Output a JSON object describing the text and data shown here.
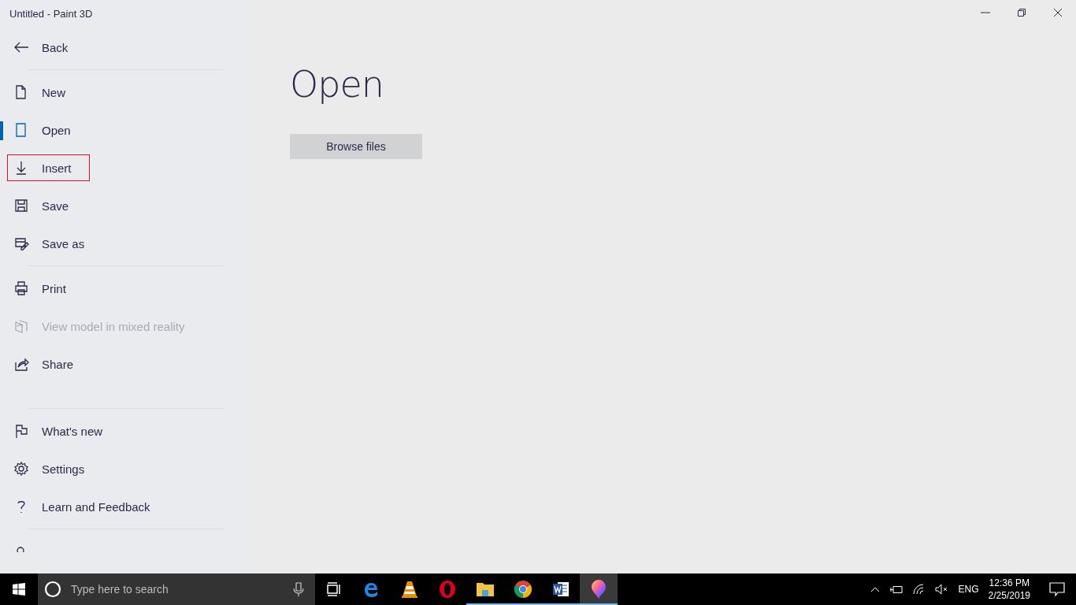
{
  "window": {
    "title": "Untitled - Paint 3D"
  },
  "sidebar": {
    "back": "Back",
    "groups": [
      [
        {
          "label": "New",
          "selected": false,
          "disabled": false,
          "focused": false
        },
        {
          "label": "Open",
          "selected": true,
          "disabled": false,
          "focused": false
        },
        {
          "label": "Insert",
          "selected": false,
          "disabled": false,
          "focused": true
        },
        {
          "label": "Save",
          "selected": false,
          "disabled": false,
          "focused": false
        },
        {
          "label": "Save as",
          "selected": false,
          "disabled": false,
          "focused": false
        }
      ],
      [
        {
          "label": "Print",
          "selected": false,
          "disabled": false,
          "focused": false
        },
        {
          "label": "View model in mixed reality",
          "selected": false,
          "disabled": true,
          "focused": false
        },
        {
          "label": "Share",
          "selected": false,
          "disabled": false,
          "focused": false
        }
      ],
      [
        {
          "label": "What's new",
          "selected": false,
          "disabled": false,
          "focused": false
        },
        {
          "label": "Settings",
          "selected": false,
          "disabled": false,
          "focused": false
        },
        {
          "label": "Learn and Feedback",
          "selected": false,
          "disabled": false,
          "focused": false
        }
      ]
    ]
  },
  "main": {
    "heading": "Open",
    "button": "Browse files"
  },
  "taskbar": {
    "search": {
      "placeholder": "Type here to search"
    },
    "apps": [
      {
        "running": false,
        "selected": false
      },
      {
        "running": false,
        "selected": false
      },
      {
        "running": false,
        "selected": false
      },
      {
        "running": false,
        "selected": false
      },
      {
        "running": true,
        "selected": false
      },
      {
        "running": true,
        "selected": false
      },
      {
        "running": true,
        "selected": false
      },
      {
        "running": true,
        "selected": true
      }
    ],
    "language": "ENG",
    "time": "12:36 PM",
    "date": "2/25/2019"
  }
}
